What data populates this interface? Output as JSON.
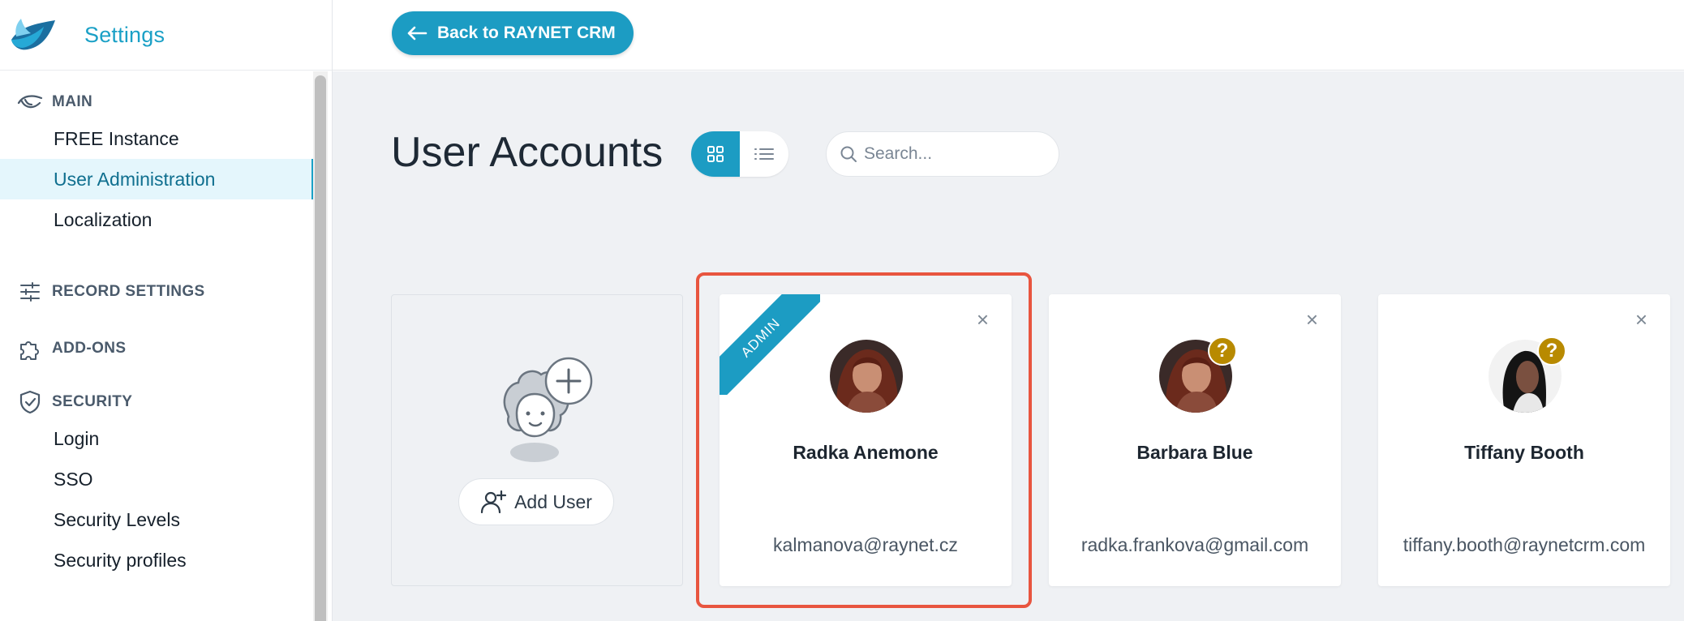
{
  "app": {
    "title": "Settings",
    "logo_icon": "raynet-bird-logo",
    "accent": "#1c9cc3"
  },
  "topbar": {
    "back_label": "Back to RAYNET CRM"
  },
  "sidebar": {
    "sections": [
      {
        "label": "MAIN",
        "icon": "main-icon",
        "items": [
          "FREE Instance",
          "User Administration",
          "Localization"
        ]
      },
      {
        "label": "RECORD SETTINGS",
        "icon": "sliders-icon",
        "items": []
      },
      {
        "label": "ADD-ONS",
        "icon": "puzzle-icon",
        "items": []
      },
      {
        "label": "SECURITY",
        "icon": "shield-icon",
        "items": [
          "Login",
          "SSO",
          "Security Levels",
          "Security profiles"
        ]
      }
    ],
    "active_item": "User Administration"
  },
  "main": {
    "title": "User Accounts",
    "view_modes": [
      "grid",
      "list"
    ],
    "active_view": "grid",
    "search_placeholder": "Search...",
    "add_user_label": "Add User",
    "users": [
      {
        "name": "Radka Anemone",
        "email": "kalmanova@raynet.cz",
        "badge": "ADMIN",
        "status": ""
      },
      {
        "name": "Barbara Blue",
        "email": "radka.frankova@gmail.com",
        "badge": "",
        "status": "?"
      },
      {
        "name": "Tiffany Booth",
        "email": "tiffany.booth@raynetcrm.com",
        "badge": "",
        "status": "?"
      }
    ],
    "close_glyph": "×"
  }
}
